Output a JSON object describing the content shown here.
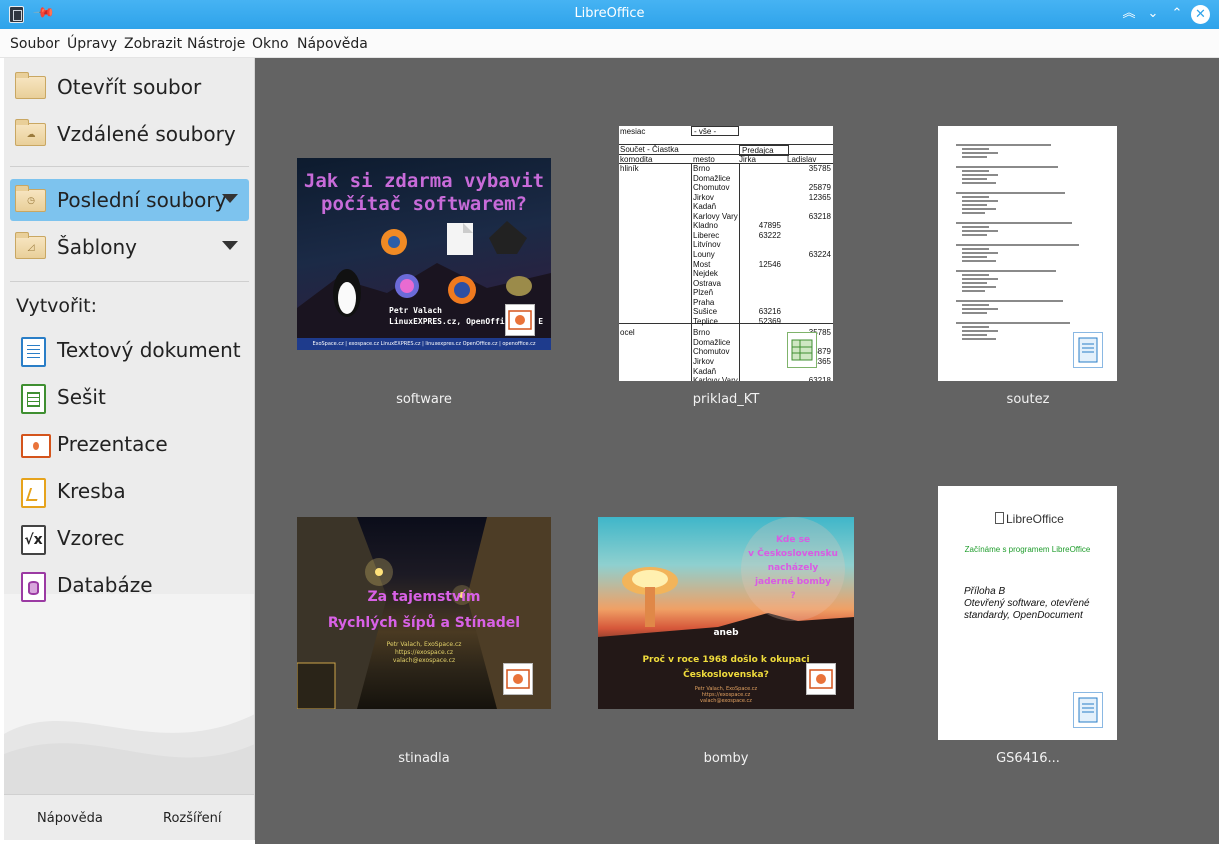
{
  "window": {
    "title": "LibreOffice"
  },
  "menu": [
    "Soubor",
    "Úpravy",
    "Zobrazit",
    "Nástroje",
    "Okno",
    "Nápověda"
  ],
  "sidebar": {
    "open_file": "Otevřít soubor",
    "remote_files": "Vzdálené soubory",
    "recent_files": "Poslední soubory",
    "templates": "Šablony",
    "create_label": "Vytvořit:",
    "create": [
      {
        "label": "Textový dokument",
        "icon": "writer-icon",
        "color": "#2a7ec7"
      },
      {
        "label": "Sešit",
        "icon": "calc-icon",
        "color": "#3f8f31"
      },
      {
        "label": "Prezentace",
        "icon": "impress-icon",
        "color": "#d4541c"
      },
      {
        "label": "Kresba",
        "icon": "draw-icon",
        "color": "#e6a31c"
      },
      {
        "label": "Vzorec",
        "icon": "math-icon",
        "color": "#444444"
      },
      {
        "label": "Databáze",
        "icon": "base-icon",
        "color": "#9b3aa3"
      }
    ],
    "footer": {
      "help": "Nápověda",
      "extensions": "Rozšíření"
    }
  },
  "recent": [
    {
      "name": "software",
      "type": "presentation",
      "title_lines": [
        "Jak si zdarma vybavit",
        "počítač softwarem?"
      ],
      "author_lines": [
        "Petr Valach",
        "LinuxEXPRES.cz, OpenOffice.cz, E"
      ],
      "footer": "ExoSpace.cz | exospace.cz     LinuxEXPRES.cz | linuxexpres.cz     OpenOffice.cz | openoffice.cz"
    },
    {
      "name": "priklad_KT",
      "type": "spreadsheet",
      "header": {
        "a": "mesiac",
        "b": "- vše -",
        "sum": "Součet - Čiastka",
        "pred": "Predajca",
        "komodita": "komodita",
        "mesto": "mesto",
        "p1": "Jirka",
        "p2": "Ladislav"
      },
      "rows": [
        {
          "k": "hliník",
          "m": "Brno",
          "a": "",
          "b": "35785"
        },
        {
          "k": "",
          "m": "Domažlice",
          "a": "",
          "b": ""
        },
        {
          "k": "",
          "m": "Chomutov",
          "a": "",
          "b": "25879"
        },
        {
          "k": "",
          "m": "Jirkov",
          "a": "",
          "b": "12365"
        },
        {
          "k": "",
          "m": "Kadaň",
          "a": "",
          "b": ""
        },
        {
          "k": "",
          "m": "Karlovy Vary",
          "a": "",
          "b": "63218"
        },
        {
          "k": "",
          "m": "Kladno",
          "a": "47895",
          "b": ""
        },
        {
          "k": "",
          "m": "Liberec",
          "a": "63222",
          "b": ""
        },
        {
          "k": "",
          "m": "Litvínov",
          "a": "",
          "b": ""
        },
        {
          "k": "",
          "m": "Louny",
          "a": "",
          "b": "63224"
        },
        {
          "k": "",
          "m": "Most",
          "a": "12546",
          "b": ""
        },
        {
          "k": "",
          "m": "Nejdek",
          "a": "",
          "b": ""
        },
        {
          "k": "",
          "m": "Ostrava",
          "a": "",
          "b": ""
        },
        {
          "k": "",
          "m": "Plzeň",
          "a": "",
          "b": ""
        },
        {
          "k": "",
          "m": "Praha",
          "a": "",
          "b": ""
        },
        {
          "k": "",
          "m": "Sušice",
          "a": "63216",
          "b": ""
        },
        {
          "k": "",
          "m": "Teplice",
          "a": "52369",
          "b": ""
        },
        {
          "k": "ocel",
          "m": "Brno",
          "a": "",
          "b": "35785"
        },
        {
          "k": "",
          "m": "Domažlice",
          "a": "",
          "b": ""
        },
        {
          "k": "",
          "m": "Chomutov",
          "a": "",
          "b": "5879"
        },
        {
          "k": "",
          "m": "Jirkov",
          "a": "",
          "b": "2365"
        },
        {
          "k": "",
          "m": "Kadaň",
          "a": "",
          "b": ""
        },
        {
          "k": "",
          "m": "Karlovy Vary",
          "a": "",
          "b": "63218"
        }
      ]
    },
    {
      "name": "soutez",
      "type": "text"
    },
    {
      "name": "stinadla",
      "type": "presentation",
      "title_lines": [
        "Za tajemstvím",
        "Rychlých šípů a Stínadel"
      ],
      "sub_lines": [
        "Petr Valach, ExoSpace.cz",
        "https://exospace.cz",
        "valach@exospace.cz"
      ]
    },
    {
      "name": "bomby",
      "type": "presentation",
      "title_lines": [
        "Kde se",
        "v Československu",
        "nacházely",
        "jaderné bomby",
        "?"
      ],
      "aneb": "aneb",
      "yellow_lines": [
        "Proč v roce 1968 došlo k okupaci",
        "Československa?"
      ],
      "sub_lines": [
        "Petr Valach, ExoSpace.cz",
        "https://exospace.cz",
        "valach@exospace.cz"
      ]
    },
    {
      "name": "GS6416...",
      "type": "text",
      "logo": "LibreOffice",
      "subtitle": "Začínáme s programem LibreOffice",
      "body_lines": [
        "Příloha B",
        "Otevřený software, otevřené",
        "standardy, OpenDocument"
      ]
    }
  ]
}
